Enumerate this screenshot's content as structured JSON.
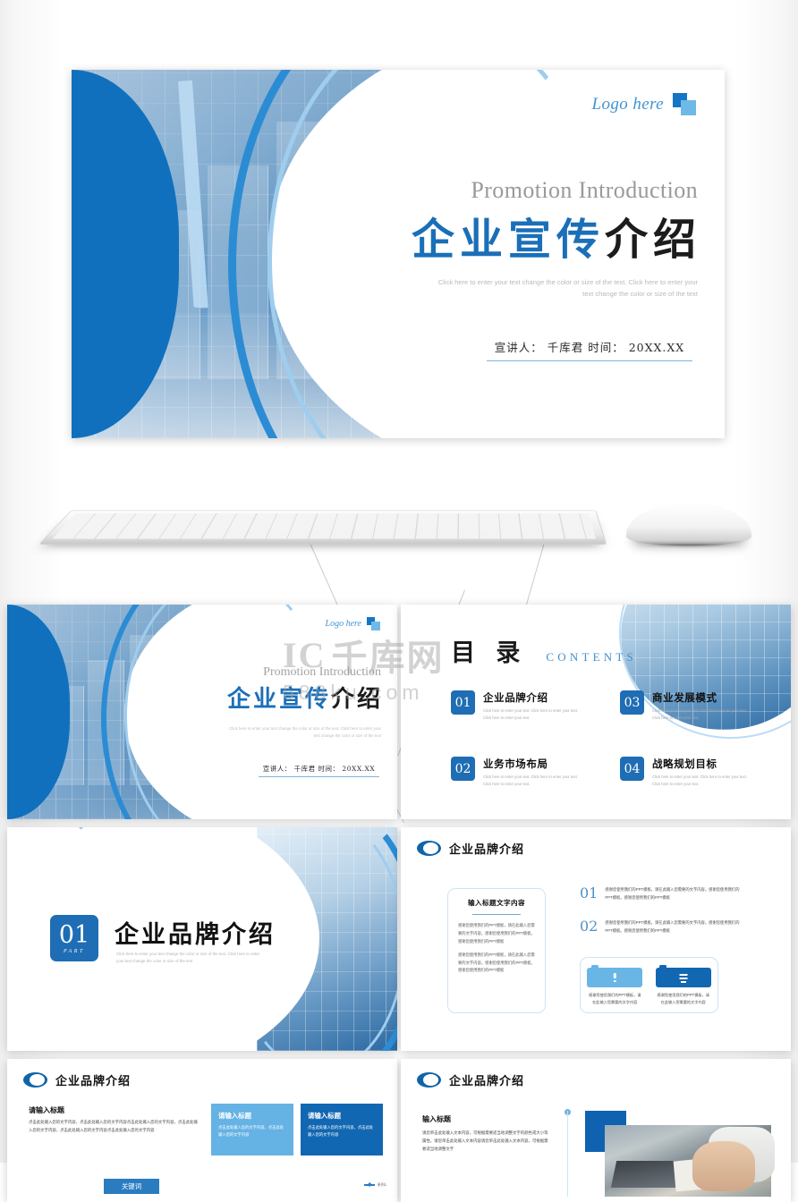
{
  "brand": {
    "accent_blue": "#1a6fb8",
    "badge_blue": "#1f6db4",
    "light_blue": "#69b6e6",
    "logo_text": "Logo here"
  },
  "cover": {
    "logo_text": "Logo here",
    "english_title": "Promotion Introduction",
    "title_blue": "企业宣传",
    "title_black": "介绍",
    "description": "Click here to enter your text change the color or size of the text. Click here to enter your text change the color or size of the text",
    "presenter_line": "宣讲人： 千库君      时间： 20XX.XX"
  },
  "toc": {
    "title_cn": "目 录",
    "title_en": "CONTENTS",
    "items": [
      {
        "num": "01",
        "label": "企业品牌介绍",
        "desc": "Click here to enter your text. Click here to enter your text. Click here to enter your text."
      },
      {
        "num": "02",
        "label": "业务市场布局",
        "desc": "Click here to enter your text. Click here to enter your text. Click here to enter your text."
      },
      {
        "num": "03",
        "label": "商业发展模式",
        "desc": "Click here to enter your text. Click here to enter your text. Click here to enter your text."
      },
      {
        "num": "04",
        "label": "战略规划目标",
        "desc": "Click here to enter your text. Click here to enter your text. Click here to enter your text."
      }
    ]
  },
  "part": {
    "num": "01",
    "word": "PART",
    "title": "企业品牌介绍",
    "desc": "Click here to enter your text change the color or size of the text. Click here to enter your text change the color or size of the text"
  },
  "content1": {
    "header": "企业品牌介绍",
    "card_title": "输入标题文字内容",
    "card_p1": "感谢您使用我们的PPT模板，请在此输入您需要的文字内容。感谢您使用我们的PPT模板。感谢您使用我们的PPT模板",
    "card_p2": "感谢您使用我们的PPT模板，请在此输入您需要的文字内容。感谢您使用我们的PPT模板。感谢您使用我们的PPT模板",
    "rows": [
      {
        "num": "01",
        "text": "感谢您使用我们的PPT模板，请在此输入您需要的文字内容。感谢您使用我们的PPT模板。感谢您使用我们的PPT模板"
      },
      {
        "num": "02",
        "text": "感谢您使用我们的PPT模板，请在此输入您需要的文字内容。感谢您使用我们的PPT模板。感谢您使用我们的PPT模板"
      }
    ],
    "icons": [
      {
        "icon": "clipboard-alert-icon",
        "text": "感谢您使用我们的PPT模板，请在此输入您需要的文字内容"
      },
      {
        "icon": "clipboard-list-icon",
        "text": "感谢您使用我们的PPT模板，请在此输入您需要的文字内容"
      }
    ]
  },
  "content2": {
    "header": "企业品牌介绍",
    "left_title": "请输入标题",
    "left_text": "点击此处输入您的文字内容，点击此处输入您的文字内容点击此处输入您的文字内容，点击此处输入您的文字内容，点击此处输入您的文字内容点击此处输入您的文字内容",
    "tiles": [
      {
        "title": "请输入标题",
        "text": "点击此处输入您的文字内容，点击此处输入您的文字内容",
        "color": "#65b2e4"
      },
      {
        "title": "请输入标题",
        "text": "点击此处输入您的文字内容，点击此处输入您的文字内容",
        "color": "#1167b2"
      }
    ],
    "keyword_button": "关键词",
    "legend": "系列1"
  },
  "content3": {
    "header": "企业品牌介绍",
    "title": "输入标题",
    "text": "请您单击此处输入文本内容，可根据需要适当地调整文字的颜色或大小等属性。请您单击此处输入文本内容请您单击此处输入文本内容，可根据需要适当地调整文字"
  },
  "watermark": {
    "ic": "IC",
    "cn": "千库网",
    "url": "588ku.com"
  },
  "devices": {
    "keyboard": "keyboard-device",
    "mouse": "mouse-device"
  }
}
